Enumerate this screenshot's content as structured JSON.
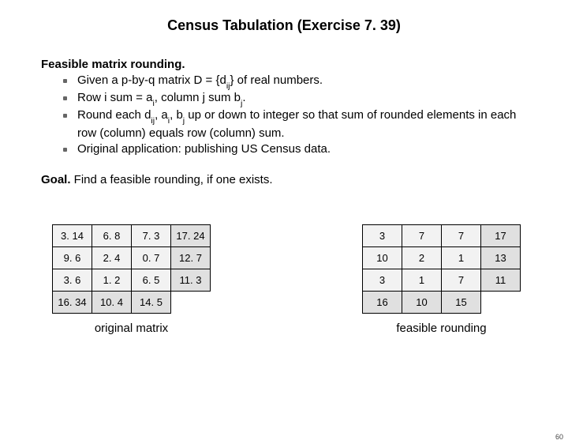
{
  "title": "Census Tabulation  (Exercise 7. 39)",
  "heading1": "Feasible matrix rounding.",
  "bullets": {
    "b0a": "Given a p-by-q matrix D = {d",
    "b0b": "} of real numbers.",
    "b1a": "Row i sum = a",
    "b1b": ", column j sum b",
    "b1c": ".",
    "b2a": "Round each d",
    "b2b": ", a",
    "b2c": ", b",
    "b2d": "  up or down to integer so that sum of rounded elements in each row (column) equals row (column) sum.",
    "b3": "Original application:  publishing US Census data."
  },
  "subs": {
    "ij": "ij",
    "i": "i",
    "j": "j"
  },
  "goal_label": "Goal.",
  "goal_text": "  Find a feasible rounding, if one exists.",
  "left_table": {
    "caption": "original matrix",
    "rows": [
      [
        "3. 14",
        "6. 8",
        "7. 3",
        "17. 24"
      ],
      [
        "9. 6",
        "2. 4",
        "0. 7",
        "12. 7"
      ],
      [
        "3. 6",
        "1. 2",
        "6. 5",
        "11. 3"
      ],
      [
        "16. 34",
        "10. 4",
        "14. 5",
        ""
      ]
    ]
  },
  "right_table": {
    "caption": "feasible rounding",
    "rows": [
      [
        "3",
        "7",
        "7",
        "17"
      ],
      [
        "10",
        "2",
        "1",
        "13"
      ],
      [
        "3",
        "1",
        "7",
        "11"
      ],
      [
        "16",
        "10",
        "15",
        ""
      ]
    ]
  },
  "pagenum": "60"
}
